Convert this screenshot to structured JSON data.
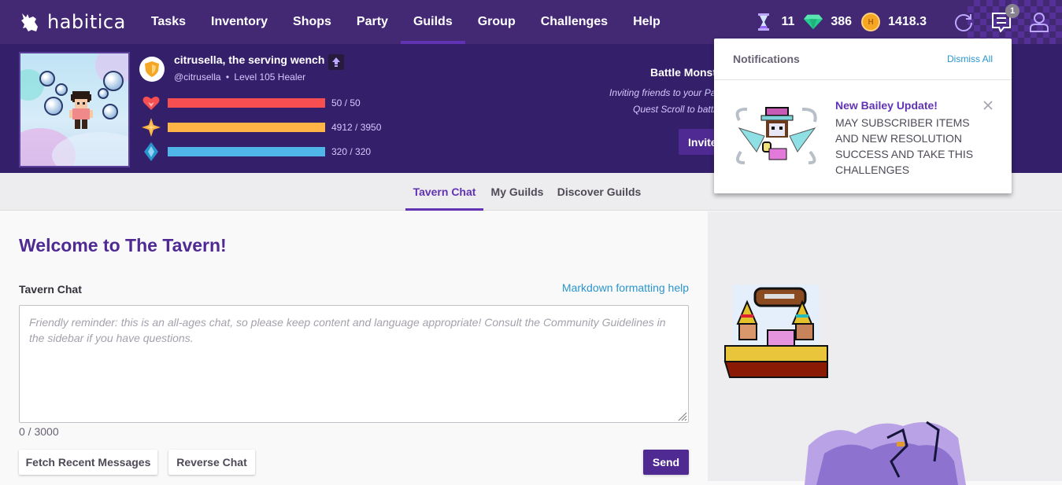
{
  "app": {
    "logo_text": "habitica"
  },
  "topnav": {
    "items": [
      {
        "label": "Tasks",
        "active": false
      },
      {
        "label": "Inventory",
        "active": false
      },
      {
        "label": "Shops",
        "active": false
      },
      {
        "label": "Party",
        "active": false
      },
      {
        "label": "Guilds",
        "active": true
      },
      {
        "label": "Group",
        "active": false
      },
      {
        "label": "Challenges",
        "active": false
      },
      {
        "label": "Help",
        "active": false
      }
    ],
    "currencies": {
      "hourglasses": "11",
      "gems": "386",
      "gold": "1418.3"
    },
    "notification_count": "1"
  },
  "member": {
    "display_name": "citrusella, the serving wench",
    "username": "@citrusella",
    "separator": "•",
    "level_class": "Level 105 Healer",
    "stats": [
      {
        "name": "health",
        "text": "50 / 50",
        "fraction": 1.0,
        "color": "#f74e52"
      },
      {
        "name": "experience",
        "text": "4912 / 3950",
        "fraction": 1.0,
        "color": "#ffb445"
      },
      {
        "name": "mana",
        "text": "320 / 320",
        "fraction": 1.0,
        "color": "#50b5e9"
      }
    ]
  },
  "party_promo": {
    "title": "Battle Monst",
    "line1": "Inviting friends to your Pa",
    "line2": "Quest Scroll to battl",
    "invite_label": "Invite"
  },
  "subnav": {
    "tabs": [
      {
        "label": "Tavern Chat",
        "active": true
      },
      {
        "label": "My Guilds",
        "active": false
      },
      {
        "label": "Discover Guilds",
        "active": false
      }
    ]
  },
  "tavern": {
    "title": "Welcome to The Tavern!",
    "chat_label": "Tavern Chat",
    "markdown_link": "Markdown formatting help",
    "chat_value": "",
    "chat_placeholder": "Friendly reminder: this is an all-ages chat, so please keep content and language appropriate! Consult the Community Guidelines in the sidebar if you have questions.",
    "counter": "0 / 3000",
    "fetch_label": "Fetch Recent Messages",
    "reverse_label": "Reverse Chat",
    "send_label": "Send"
  },
  "notifications": {
    "title": "Notifications",
    "dismiss_all": "Dismiss All",
    "items": [
      {
        "title": "New Bailey Update!",
        "body": "MAY SUBSCRIBER ITEMS AND NEW RESOLUTION SUCCESS AND TAKE THIS CHALLENGES"
      }
    ]
  },
  "colors": {
    "brand_purple": "#432874",
    "header_purple": "#34206a",
    "accent_purple": "#6133b4",
    "link_blue": "#2995cd"
  }
}
